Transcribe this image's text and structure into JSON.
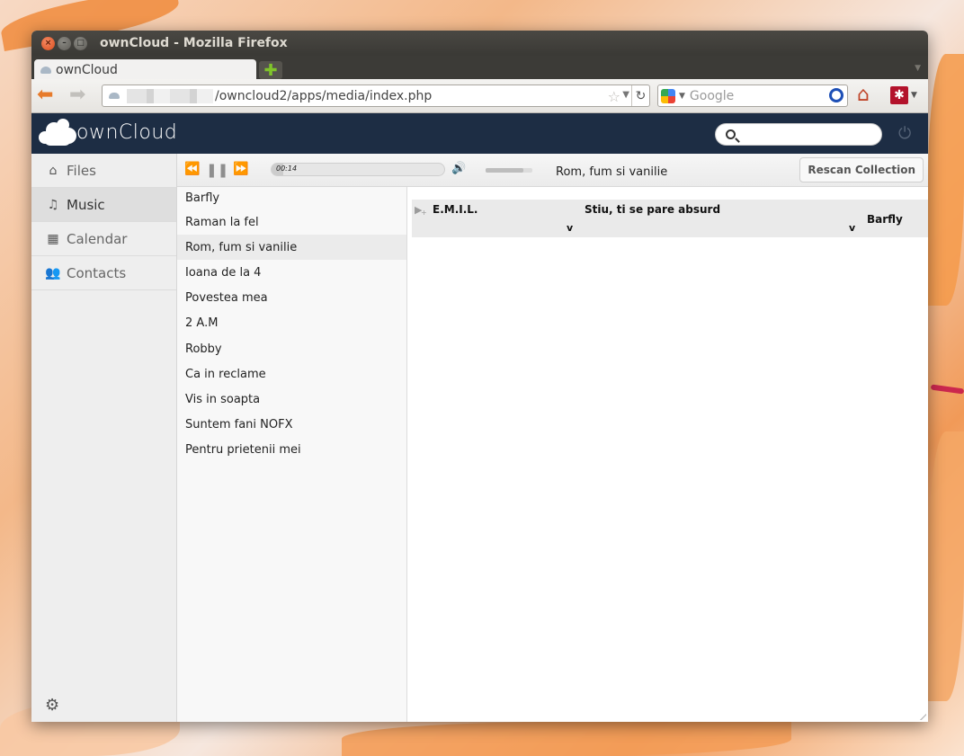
{
  "window": {
    "title": "ownCloud - Mozilla Firefox"
  },
  "browser": {
    "tab_label": "ownCloud",
    "url_path": "/owncloud2/apps/media/index.php",
    "search_placeholder": "Google",
    "new_tab_symbol": "✚"
  },
  "header": {
    "logo_text": "ownCloud",
    "search_value": ""
  },
  "sidebar": {
    "items": [
      {
        "label": "Files",
        "icon": "house-icon"
      },
      {
        "label": "Music",
        "icon": "music-note-icon"
      },
      {
        "label": "Calendar",
        "icon": "calendar-icon"
      },
      {
        "label": "Contacts",
        "icon": "people-icon"
      }
    ]
  },
  "player": {
    "time": "00:14",
    "progress_fraction": 0.07,
    "volume_fraction": 0.8,
    "now_playing": "Rom, fum si vanilie",
    "rescan_label": "Rescan Collection"
  },
  "playlist": {
    "items": [
      "Barfly",
      "Raman la fel",
      "Rom, fum si vanilie",
      "Ioana de la 4",
      "Povestea mea",
      "2 A.M",
      "Robby",
      "Ca in reclame",
      "Vis in soapta",
      "Suntem fani NOFX",
      "Pentru prietenii mei"
    ],
    "current_index": 2
  },
  "library": {
    "artist": "E.M.I.L.",
    "album": "Stiu, ti se pare absurd",
    "expand_artist": "v",
    "expand_album": "v",
    "song": "Barfly"
  }
}
